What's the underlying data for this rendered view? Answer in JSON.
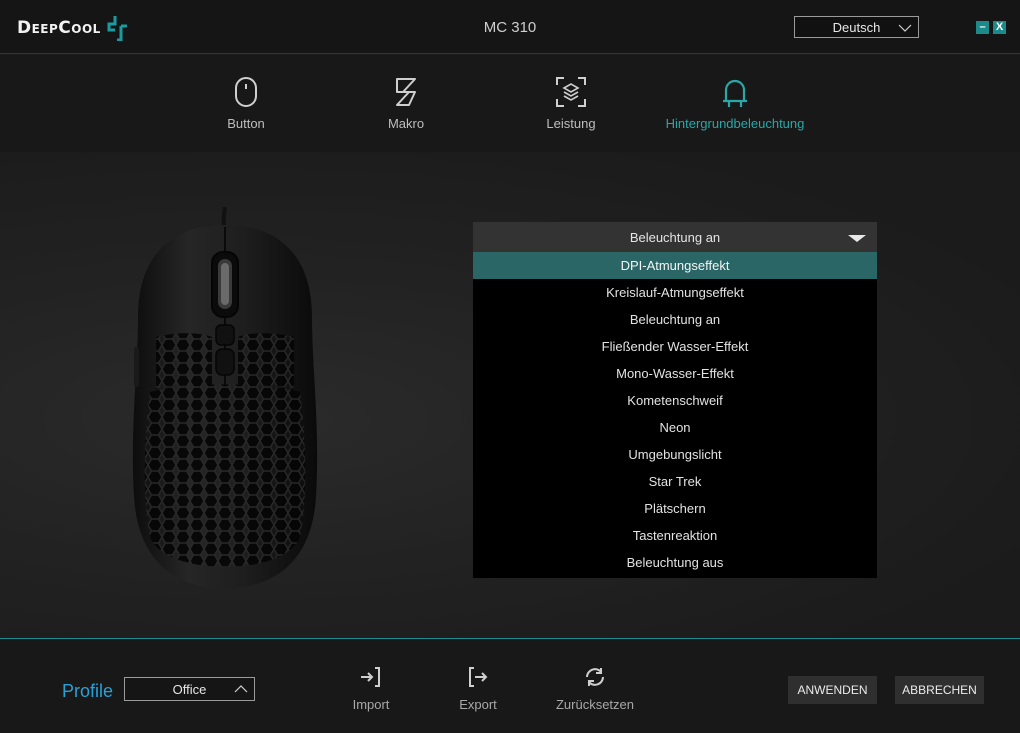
{
  "app": {
    "logo_text": "DeepCool",
    "title": "MC 310",
    "language": "Deutsch",
    "minimize_label": "–",
    "close_label": "X",
    "accent_color": "#2aa7a7"
  },
  "tabs": [
    {
      "label": "Button",
      "icon": "mouse-icon"
    },
    {
      "label": "Makro",
      "icon": "macro-icon"
    },
    {
      "label": "Leistung",
      "icon": "performance-icon"
    },
    {
      "label": "Hintergrundbeleuchtung",
      "icon": "lighting-icon",
      "active": true
    }
  ],
  "lighting": {
    "selected_mode": "Beleuchtung an",
    "options": [
      "DPI-Atmungseffekt",
      "Kreislauf-Atmungseffekt",
      "Beleuchtung an",
      "Fließender Wasser-Effekt",
      "Mono-Wasser-Effekt",
      "Kometenschweif",
      "Neon",
      "Umgebungslicht",
      "Star Trek",
      "Plätschern",
      "Tastenreaktion",
      "Beleuchtung aus"
    ],
    "highlighted_option": "DPI-Atmungseffekt"
  },
  "footer": {
    "profile_label": "Profile",
    "profile_value": "Office",
    "import_label": "Import",
    "export_label": "Export",
    "reset_label": "Zurücksetzen",
    "apply_label": "ANWENDEN",
    "cancel_label": "ABBRECHEN"
  }
}
